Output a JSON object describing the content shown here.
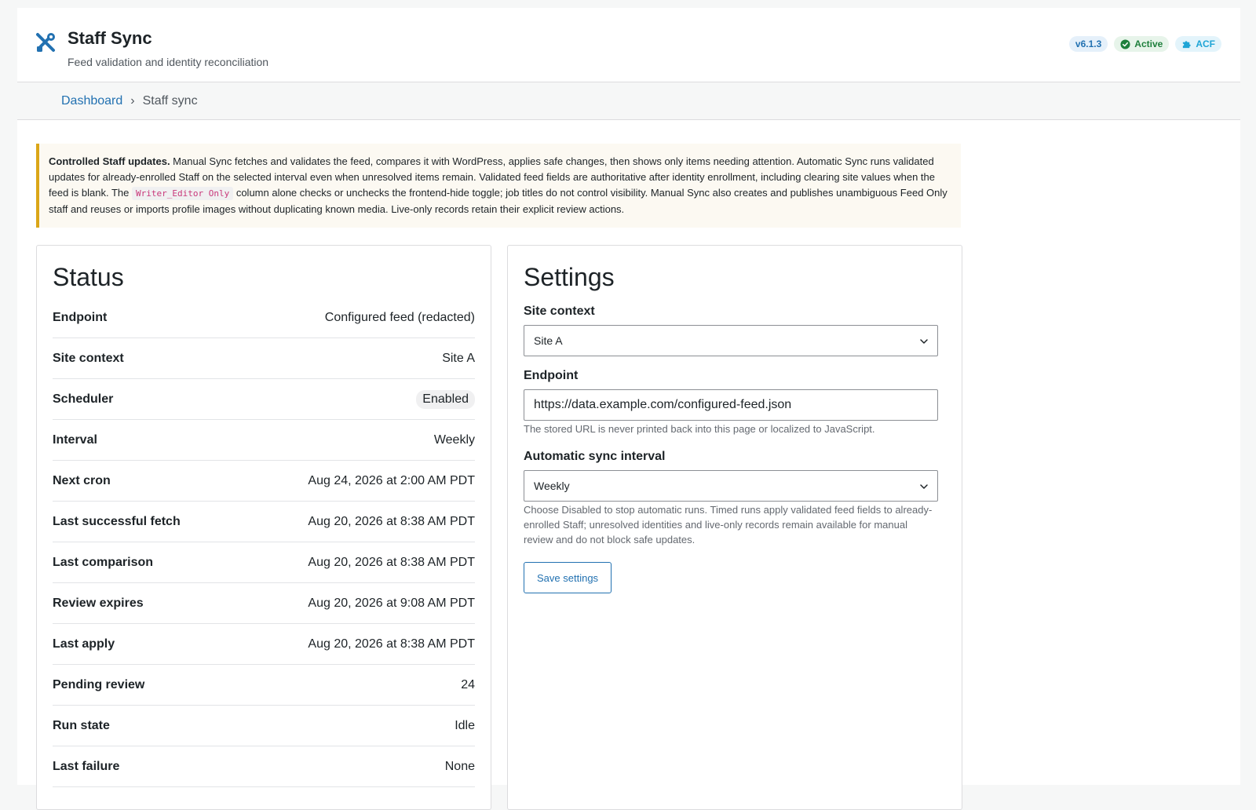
{
  "header": {
    "title": "Staff Sync",
    "subtitle": "Feed validation and identity reconciliation",
    "badges": {
      "version": "v6.1.3",
      "active": "Active",
      "acf": "ACF"
    }
  },
  "breadcrumb": {
    "home": "Dashboard",
    "separator": "›",
    "current": "Staff sync"
  },
  "notice": {
    "strong": "Controlled Staff updates.",
    "text_before_code": " Manual Sync fetches and validates the feed, compares it with WordPress, applies safe changes, then shows only items needing attention. Automatic Sync runs validated updates for already-enrolled Staff on the selected interval even when unresolved items remain. Validated feed fields are authoritative after identity enrollment, including clearing site values when the feed is blank. The ",
    "code": "Writer_Editor Only",
    "text_after_code": " column alone checks or unchecks the frontend-hide toggle; job titles do not control visibility. Manual Sync also creates and publishes unambiguous Feed Only staff and reuses or imports profile images without duplicating known media. Live-only records retain their explicit review actions."
  },
  "status": {
    "heading": "Status",
    "rows": [
      {
        "label": "Endpoint",
        "value": "Configured feed (redacted)"
      },
      {
        "label": "Site context",
        "value": "Site A"
      },
      {
        "label": "Scheduler",
        "value": "Enabled"
      },
      {
        "label": "Interval",
        "value": "Weekly"
      },
      {
        "label": "Next cron",
        "value": "Aug 24, 2026 at 2:00 AM PDT"
      },
      {
        "label": "Last successful fetch",
        "value": "Aug 20, 2026 at 8:38 AM PDT"
      },
      {
        "label": "Last comparison",
        "value": "Aug 20, 2026 at 8:38 AM PDT"
      },
      {
        "label": "Review expires",
        "value": "Aug 20, 2026 at 9:08 AM PDT"
      },
      {
        "label": "Last apply",
        "value": "Aug 20, 2026 at 8:38 AM PDT"
      },
      {
        "label": "Pending review",
        "value": "24"
      },
      {
        "label": "Run state",
        "value": "Idle"
      },
      {
        "label": "Last failure",
        "value": "None"
      }
    ]
  },
  "settings": {
    "heading": "Settings",
    "site_context": {
      "label": "Site context",
      "value": "Site A"
    },
    "endpoint": {
      "label": "Endpoint",
      "value": "https://data.example.com/configured-feed.json",
      "help": "The stored URL is never printed back into this page or localized to JavaScript."
    },
    "interval": {
      "label": "Automatic sync interval",
      "value": "Weekly",
      "help": "Choose Disabled to stop automatic runs. Timed runs apply validated feed fields to already-enrolled Staff; unresolved identities and live-only records remain available for manual review and do not block safe updates."
    },
    "save_label": "Save settings"
  },
  "colors": {
    "accent": "#2271b1",
    "warning_border": "#dba617",
    "success": "#1e7f3c",
    "acf": "#1fa5d6"
  }
}
